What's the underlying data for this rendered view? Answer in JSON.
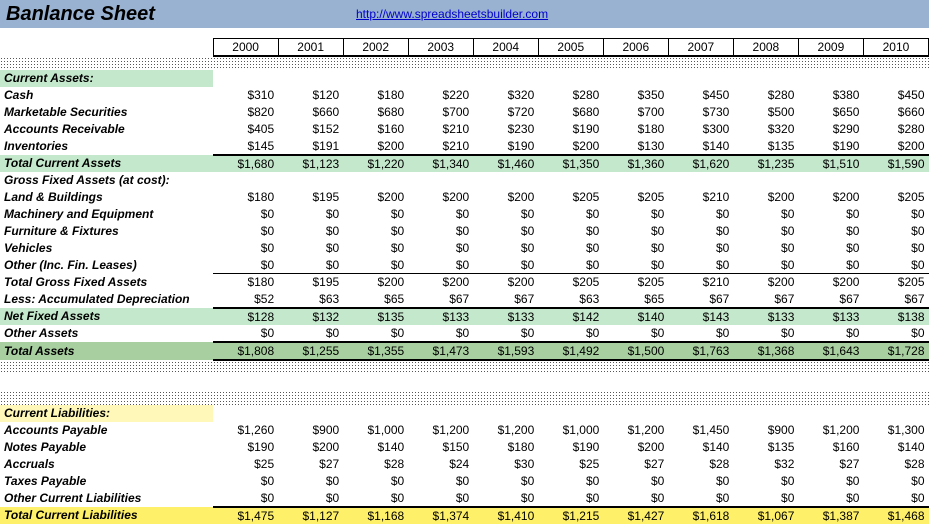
{
  "header": {
    "title": "Banlance Sheet",
    "link_text": "http://www.spreadsheetsbuilder.com",
    "link_href": "http://www.spreadsheetsbuilder.com"
  },
  "chart_data": {
    "type": "table",
    "years": [
      "2000",
      "2001",
      "2002",
      "2003",
      "2004",
      "2005",
      "2006",
      "2007",
      "2008",
      "2009",
      "2010"
    ],
    "sections": [
      {
        "heading": "Current Assets:",
        "heading_style": "green-light",
        "rows": [
          {
            "label": "Cash",
            "values": [
              "$310",
              "$120",
              "$180",
              "$220",
              "$320",
              "$280",
              "$350",
              "$450",
              "$280",
              "$380",
              "$450"
            ]
          },
          {
            "label": "Marketable Securities",
            "values": [
              "$820",
              "$660",
              "$680",
              "$700",
              "$720",
              "$680",
              "$700",
              "$730",
              "$500",
              "$650",
              "$660"
            ]
          },
          {
            "label": "Accounts Receivable",
            "values": [
              "$405",
              "$152",
              "$160",
              "$210",
              "$230",
              "$190",
              "$180",
              "$300",
              "$320",
              "$290",
              "$280"
            ]
          },
          {
            "label": "Inventories",
            "values": [
              "$145",
              "$191",
              "$200",
              "$210",
              "$190",
              "$200",
              "$130",
              "$140",
              "$135",
              "$190",
              "$200"
            ]
          }
        ],
        "total": {
          "label": "Total Current Assets",
          "style": "green-mid",
          "border": "thick-top",
          "values": [
            "$1,680",
            "$1,123",
            "$1,220",
            "$1,340",
            "$1,460",
            "$1,350",
            "$1,360",
            "$1,620",
            "$1,235",
            "$1,510",
            "$1,590"
          ]
        }
      },
      {
        "heading": "Gross Fixed Assets (at cost):",
        "heading_style": "plain",
        "rows": [
          {
            "label": "Land & Buildings",
            "values": [
              "$180",
              "$195",
              "$200",
              "$200",
              "$200",
              "$205",
              "$205",
              "$210",
              "$200",
              "$200",
              "$205"
            ]
          },
          {
            "label": "Machinery and Equipment",
            "values": [
              "$0",
              "$0",
              "$0",
              "$0",
              "$0",
              "$0",
              "$0",
              "$0",
              "$0",
              "$0",
              "$0"
            ]
          },
          {
            "label": "Furniture & Fixtures",
            "values": [
              "$0",
              "$0",
              "$0",
              "$0",
              "$0",
              "$0",
              "$0",
              "$0",
              "$0",
              "$0",
              "$0"
            ]
          },
          {
            "label": "Vehicles",
            "values": [
              "$0",
              "$0",
              "$0",
              "$0",
              "$0",
              "$0",
              "$0",
              "$0",
              "$0",
              "$0",
              "$0"
            ]
          },
          {
            "label": "Other (Inc. Fin. Leases)",
            "values": [
              "$0",
              "$0",
              "$0",
              "$0",
              "$0",
              "$0",
              "$0",
              "$0",
              "$0",
              "$0",
              "$0"
            ]
          }
        ],
        "subrows": [
          {
            "label": "Total Gross Fixed Assets",
            "border": "thin-top",
            "values": [
              "$180",
              "$195",
              "$200",
              "$200",
              "$200",
              "$205",
              "$205",
              "$210",
              "$200",
              "$200",
              "$205"
            ]
          },
          {
            "label": "Less:  Accumulated Depreciation",
            "values": [
              "$52",
              "$63",
              "$65",
              "$67",
              "$67",
              "$63",
              "$65",
              "$67",
              "$67",
              "$67",
              "$67"
            ]
          }
        ],
        "total": {
          "label": "Net Fixed Assets",
          "style": "green-mid",
          "border": "thick-top",
          "values": [
            "$128",
            "$132",
            "$135",
            "$133",
            "$133",
            "$142",
            "$140",
            "$143",
            "$133",
            "$133",
            "$138"
          ]
        },
        "after": [
          {
            "label": "Other Assets",
            "values": [
              "$0",
              "$0",
              "$0",
              "$0",
              "$0",
              "$0",
              "$0",
              "$0",
              "$0",
              "$0",
              "$0"
            ]
          }
        ],
        "grand": {
          "label": "Total Assets",
          "style": "green-dark",
          "border": "thick-top-bottom",
          "values": [
            "$1,808",
            "$1,255",
            "$1,355",
            "$1,473",
            "$1,593",
            "$1,492",
            "$1,500",
            "$1,763",
            "$1,368",
            "$1,643",
            "$1,728"
          ]
        }
      },
      {
        "heading": "Current Liabilities:",
        "heading_style": "yellow-light",
        "rows": [
          {
            "label": "Accounts Payable",
            "values": [
              "$1,260",
              "$900",
              "$1,000",
              "$1,200",
              "$1,200",
              "$1,000",
              "$1,200",
              "$1,450",
              "$900",
              "$1,200",
              "$1,300"
            ]
          },
          {
            "label": "Notes Payable",
            "values": [
              "$190",
              "$200",
              "$140",
              "$150",
              "$180",
              "$190",
              "$200",
              "$140",
              "$135",
              "$160",
              "$140"
            ]
          },
          {
            "label": "Accruals",
            "values": [
              "$25",
              "$27",
              "$28",
              "$24",
              "$30",
              "$25",
              "$27",
              "$28",
              "$32",
              "$27",
              "$28"
            ]
          },
          {
            "label": "Taxes Payable",
            "values": [
              "$0",
              "$0",
              "$0",
              "$0",
              "$0",
              "$0",
              "$0",
              "$0",
              "$0",
              "$0",
              "$0"
            ]
          },
          {
            "label": "Other Current Liabilities",
            "values": [
              "$0",
              "$0",
              "$0",
              "$0",
              "$0",
              "$0",
              "$0",
              "$0",
              "$0",
              "$0",
              "$0"
            ]
          }
        ],
        "total": {
          "label": "Total Current Liabilities",
          "style": "yellow",
          "border": "thick-top",
          "values": [
            "$1,475",
            "$1,127",
            "$1,168",
            "$1,374",
            "$1,410",
            "$1,215",
            "$1,427",
            "$1,618",
            "$1,067",
            "$1,387",
            "$1,468"
          ]
        }
      }
    ]
  }
}
